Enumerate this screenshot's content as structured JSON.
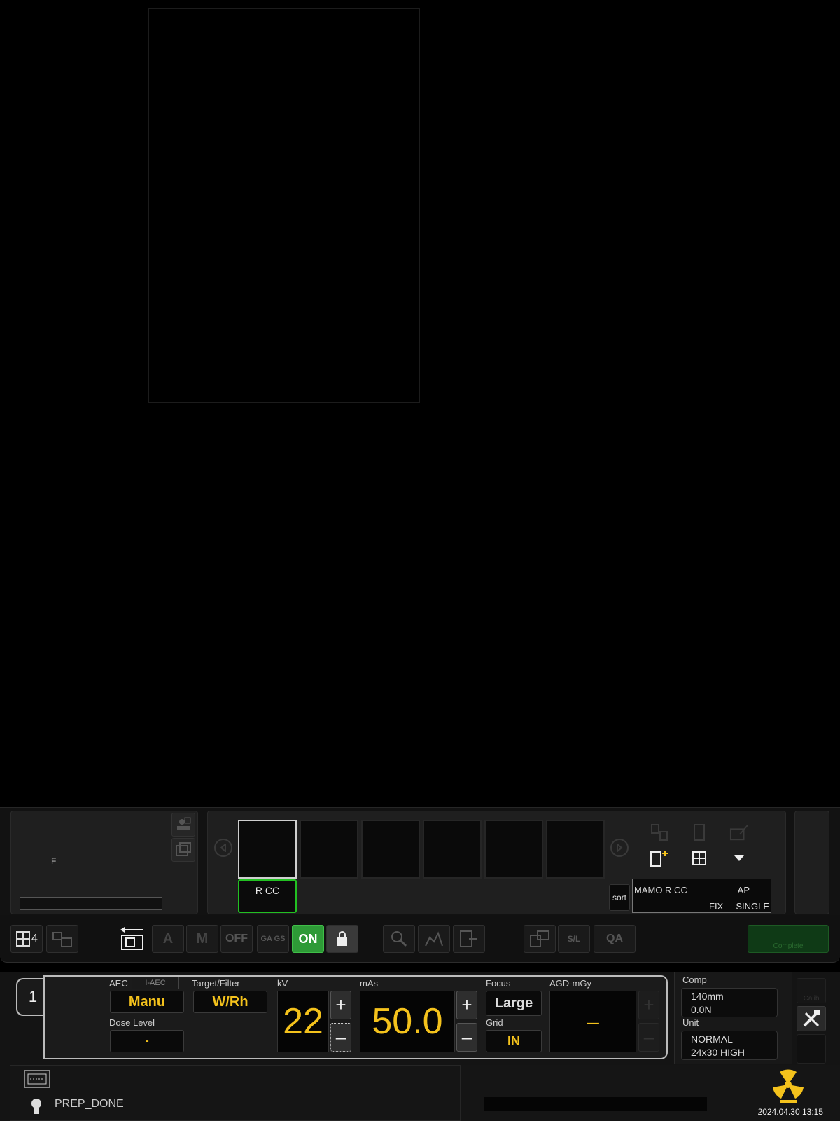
{
  "viewer": {
    "patient_side_label": "F"
  },
  "thumbnails": {
    "items": [
      {
        "active": true
      },
      {
        "active": false
      },
      {
        "active": false
      },
      {
        "active": false
      },
      {
        "active": false
      },
      {
        "active": false
      }
    ],
    "selected_label": "R CC",
    "sort_label": "sort",
    "protocol": {
      "name": "MAMO R CC",
      "position": "AP",
      "mode": "FIX",
      "type": "SINGLE"
    }
  },
  "toolbar": {
    "layout_count": "4",
    "off_label": "OFF",
    "ga_gs_label": "GA GS",
    "auto_on_label": "ON",
    "sl_label": "S/L",
    "qa_label": "QA",
    "complete_label": "Complete"
  },
  "exposure": {
    "tab_number": "1",
    "aec_label": "AEC",
    "iaec_label": "I-AEC",
    "aec_value": "Manu",
    "target_filter_label": "Target/Filter",
    "target_filter_value": "W/Rh",
    "dose_level_label": "Dose Level",
    "dose_level_value": "-",
    "kv_label": "kV",
    "kv_value": "22",
    "mas_label": "mAs",
    "mas_value": "50.0",
    "focus_label": "Focus",
    "focus_value": "Large",
    "grid_label": "Grid",
    "grid_value": "IN",
    "agd_label": "AGD-mGy",
    "agd_value": "–",
    "comp_label": "Comp",
    "comp_thickness": "140mm",
    "comp_force": "0.0N",
    "unit_label": "Unit",
    "unit_mode": "NORMAL",
    "unit_detector": "24x30 HIGH",
    "calib_label": "Calib"
  },
  "status": {
    "state": "PREP_DONE",
    "datetime": "2024.04.30 13:15"
  },
  "colors": {
    "accent_yellow": "#f4c21c",
    "active_green": "#2e9a37",
    "label_green": "#22c022"
  }
}
